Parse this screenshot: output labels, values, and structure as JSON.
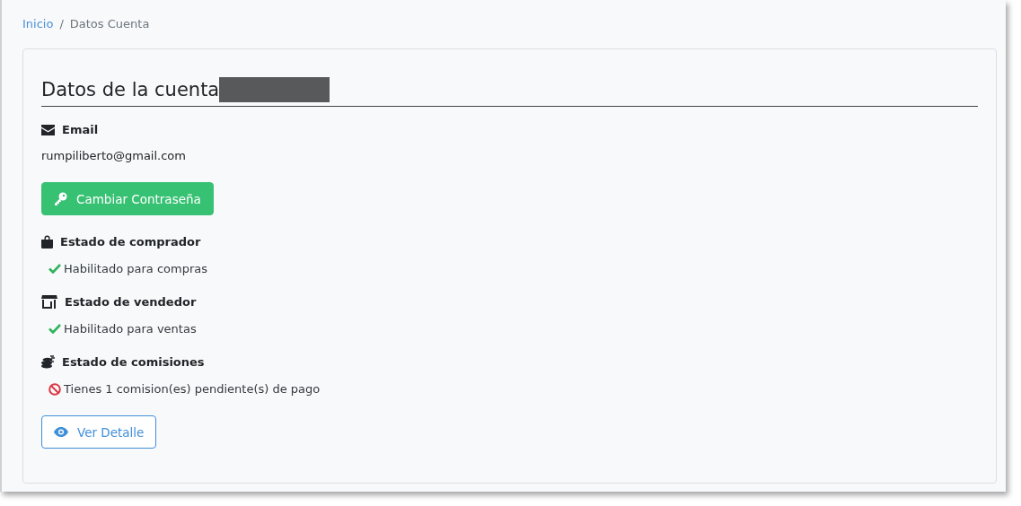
{
  "breadcrumb": [
    {
      "label": "Inicio",
      "selected": false
    },
    {
      "label": "Datos Cuenta",
      "selected": true
    }
  ],
  "breadcrumb_separator": "/",
  "title": "Datos de la cuenta",
  "title_redacted": true,
  "items": [
    {
      "kind": "field",
      "label": "Email",
      "value": "rumpiliberto@gmail.com"
    },
    {
      "kind": "button",
      "label": "Cambiar Contraseña"
    },
    {
      "kind": "status",
      "label": "Estado de comprador",
      "text": "Habilitado para compras",
      "ok": true
    },
    {
      "kind": "status",
      "label": "Estado de vendedor",
      "text": "Habilitado para ventas",
      "ok": true
    },
    {
      "kind": "status",
      "label": "Estado de comisiones",
      "text": "Tienes 1 comision(es) pendiente(s) de pago",
      "ok": false
    },
    {
      "kind": "button",
      "label": "Ver Detalle"
    }
  ]
}
